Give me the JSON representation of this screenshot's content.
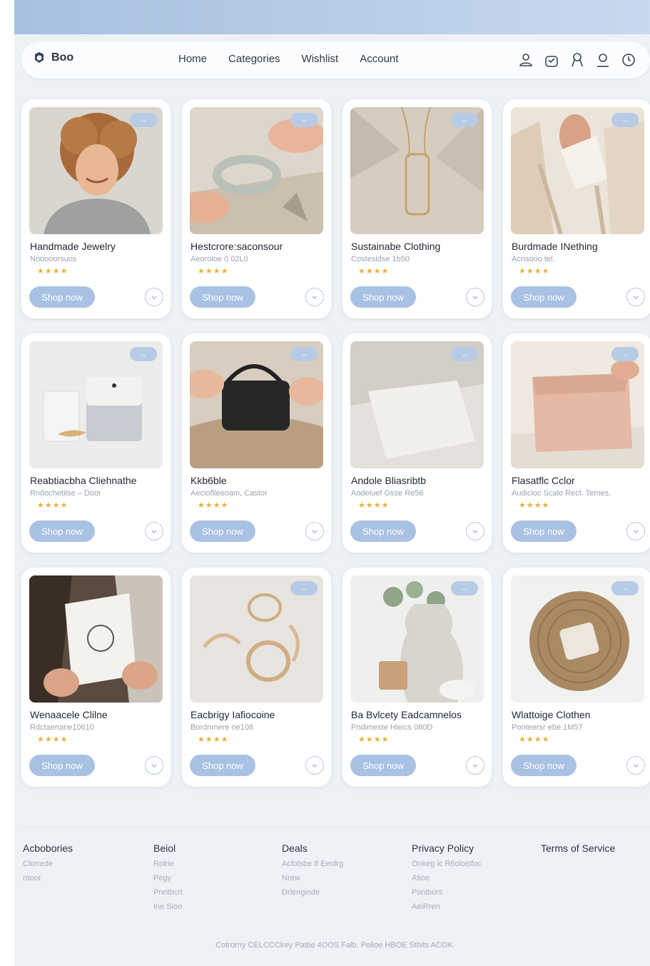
{
  "nav": {
    "logo_text": "Boo",
    "links": [
      "Home",
      "Categories",
      "Wishlist",
      "Account"
    ]
  },
  "products": [
    {
      "title": "Handmade Jewelry",
      "subtitle": "Nooooorsuos",
      "stars": "★★★★",
      "cta": "Shop now"
    },
    {
      "title": "Hestcrore:saconsour",
      "subtitle": "Aeoroloe 0 02L0",
      "stars": "★★★★",
      "cta": "Shop now"
    },
    {
      "title": "Sustainabe Clothing",
      "subtitle": "Costesidse 1b50",
      "stars": "★★★★",
      "cta": "Shop now"
    },
    {
      "title": "Burdmade INething",
      "subtitle": "Acnsooo tel.",
      "stars": "★★★★",
      "cta": "Shop now"
    },
    {
      "title": "Reabtiacbha Cliehnathe",
      "subtitle": "Rnôochetilse – Door",
      "stars": "★★★★",
      "cta": "Shop now"
    },
    {
      "title": "Kkb6ble",
      "subtitle": "Aecioflleeoam, Castor",
      "stars": "★★★★",
      "cta": "Shop now"
    },
    {
      "title": "Andole Bliasribtb",
      "subtitle": "Aodeiuef Gsse Re56",
      "stars": "★★★★",
      "cta": "Shop now"
    },
    {
      "title": "Flasatflc Cclor",
      "subtitle": "Audicioc Scalo Rect. Temes.",
      "stars": "★★★★",
      "cta": "Shop now"
    },
    {
      "title": "Wenaacele Clilne",
      "subtitle": "Rdctaenarie10610",
      "stars": "★★★★",
      "cta": "Shop now"
    },
    {
      "title": "Eacbrigy Iafiocoine",
      "subtitle": "Bordnmere ne108",
      "stars": "★★★★",
      "cta": "Shop now"
    },
    {
      "title": "Ba Bvlcety Eadcamnelos",
      "subtitle": "Pndimeste Hleics 080D",
      "stars": "★★★★",
      "cta": "Shop now"
    },
    {
      "title": "Wlattoige Clothen",
      "subtitle": "Ponteersr ebe 1M57",
      "stars": "★★★★",
      "cta": "Shop now"
    }
  ],
  "footer": {
    "columns": [
      {
        "heading": "Acbobories",
        "links": [
          "Clorrede",
          "rooor"
        ]
      },
      {
        "heading": "Beiol",
        "links": [
          "Rolrie",
          "Pegy",
          "Pnntbcrt",
          "Ine Sioo"
        ]
      },
      {
        "heading": "Deals",
        "links": [
          "Acfolsbe 8 Eeolrg",
          "Nrew",
          "Drlenginde"
        ]
      },
      {
        "heading": "Privacy Policy",
        "links": [
          "Onkeg ic R6oloisfoc",
          "Atioe",
          "Ponlbors",
          "AeiRren"
        ]
      },
      {
        "heading": "Terms of Service",
        "links": []
      }
    ],
    "copyright": "Cotrorny CELCCClrey Pattie 4OOS Falb. Pelioe HBOE Sthits ACOK."
  },
  "colors": {
    "accent": "#a9c2e3",
    "star": "#e3b33d",
    "page_bg": "#eef1f5",
    "header_band": "#b8cde8"
  }
}
